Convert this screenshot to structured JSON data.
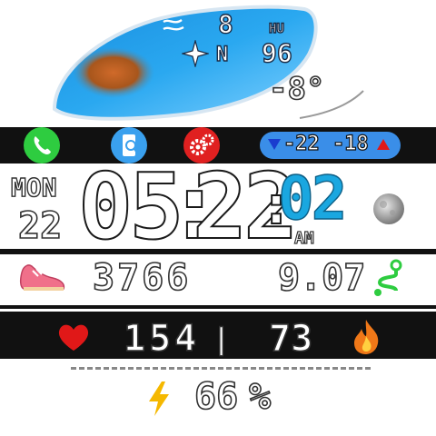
{
  "weather": {
    "wind_speed": "8",
    "wind_direction": "N",
    "humidity_label": "HU",
    "humidity_value": "96",
    "temperature": "-8°"
  },
  "shortcuts": {
    "temp_low": "-22",
    "temp_high": "-18"
  },
  "date": {
    "weekday": "MON",
    "day": "22"
  },
  "time": {
    "hours": "05",
    "minutes": "22",
    "seconds": "02",
    "ampm": "AM"
  },
  "activity": {
    "steps": "3766",
    "distance": "9.07"
  },
  "health": {
    "heart_rate": "154",
    "separator": "|",
    "calories": "73"
  },
  "battery": {
    "level": "66",
    "unit": "%"
  },
  "colors": {
    "accent": "#1aa7e0",
    "phone_green": "#2ecc40",
    "settings_red": "#e02020",
    "pill_blue": "#3a8ee8"
  }
}
